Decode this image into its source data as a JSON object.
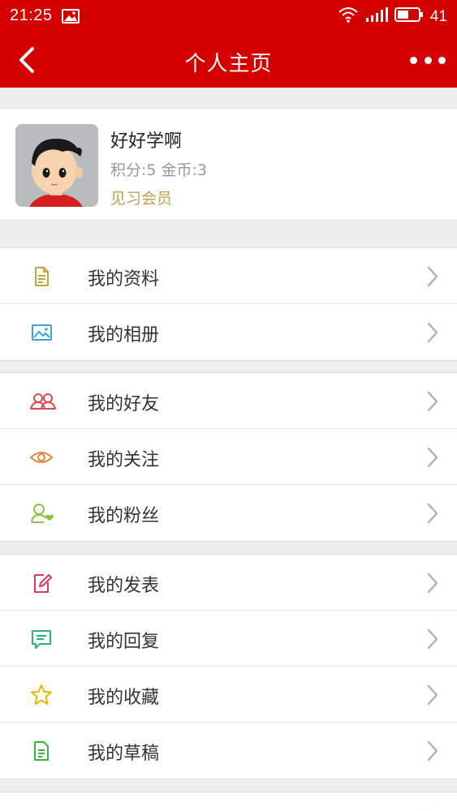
{
  "status_bar": {
    "time": "21:25",
    "battery": "41"
  },
  "nav": {
    "title": "个人主页"
  },
  "profile": {
    "name": "好好学啊",
    "stats": "积分:5 金币:3",
    "level": "见习会员"
  },
  "menu": [
    {
      "label": "我的资料",
      "icon": "document-icon",
      "color": "#c9a531"
    },
    {
      "label": "我的相册",
      "icon": "image-icon",
      "color": "#3ba3d9"
    },
    {
      "label": "我的好友",
      "icon": "friends-icon",
      "color": "#e0484e"
    },
    {
      "label": "我的关注",
      "icon": "eye-icon",
      "color": "#e0863a"
    },
    {
      "label": "我的粉丝",
      "icon": "fan-user-icon",
      "color": "#8cc63f"
    },
    {
      "label": "我的发表",
      "icon": "edit-post-icon",
      "color": "#e0365f"
    },
    {
      "label": "我的回复",
      "icon": "comment-icon",
      "color": "#2db37d"
    },
    {
      "label": "我的收藏",
      "icon": "star-icon",
      "color": "#f0b400"
    },
    {
      "label": "我的草稿",
      "icon": "draft-icon",
      "color": "#3ab53a"
    }
  ]
}
